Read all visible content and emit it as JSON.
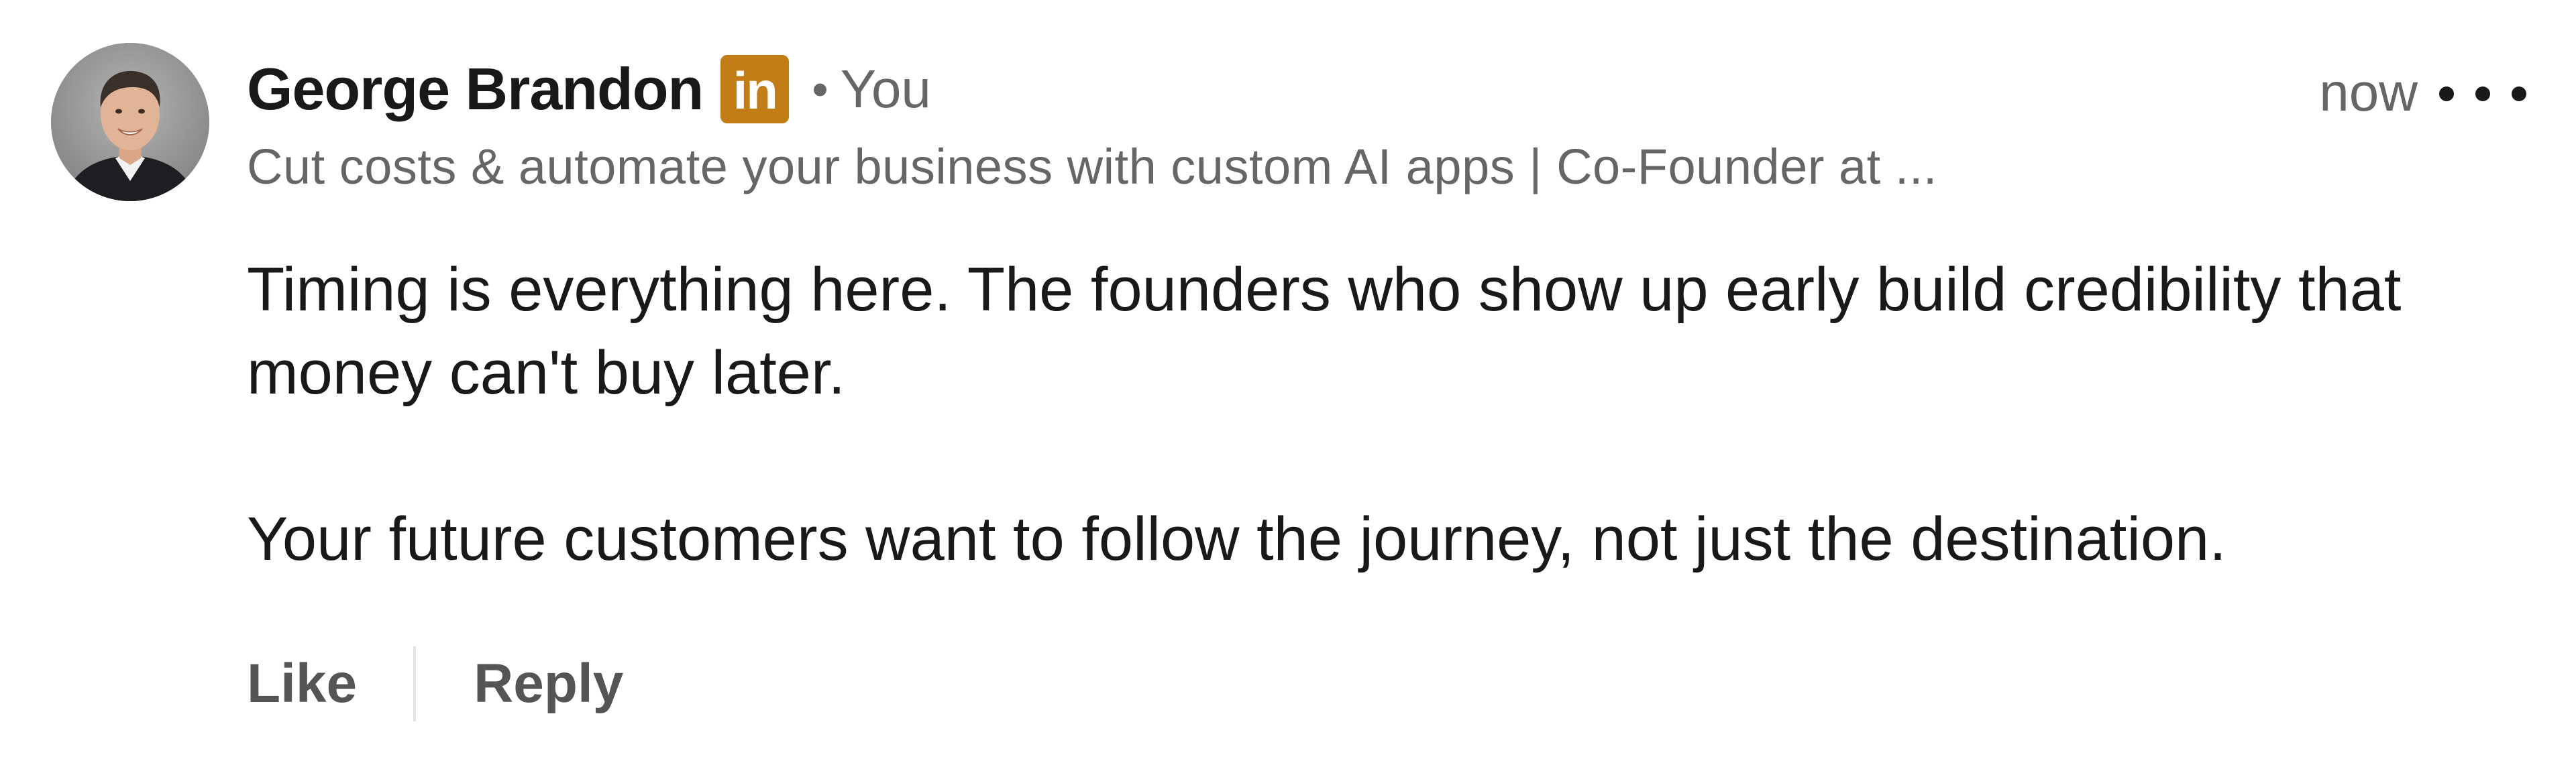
{
  "comment": {
    "author": {
      "name": "George Brandon",
      "badge_text": "in",
      "badge_color": "#c37d16",
      "separator": "•",
      "relation": "You",
      "headline": "Cut costs & automate your business with custom AI apps | Co-Founder at ...",
      "avatar_icon": "person-avatar"
    },
    "timestamp": "now",
    "more_icon": "ellipsis-icon",
    "body": {
      "paragraph_1": "Timing is everything here. The founders who show up early build credibility that money can't buy later.",
      "paragraph_2": "Your future customers want to follow the journey, not just the destination."
    },
    "actions": {
      "like_label": "Like",
      "reply_label": "Reply"
    }
  }
}
